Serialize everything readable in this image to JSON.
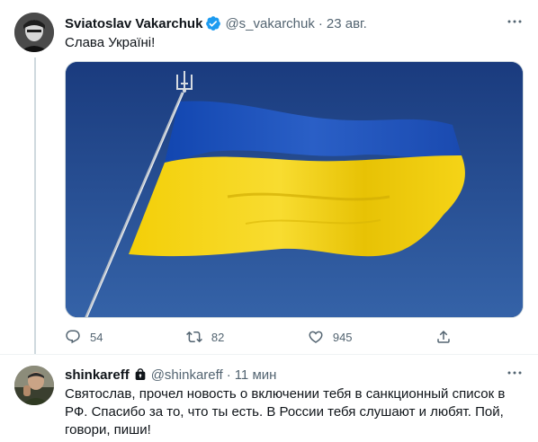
{
  "tweet": {
    "author": {
      "name": "Sviatoslav Vakarchuk",
      "handle": "@s_vakarchuk",
      "verified": true
    },
    "time": "23 авг.",
    "text": "Слава Україні!",
    "media": {
      "description": "Ukrainian flag on flagpole with trident finial",
      "colors": {
        "top": "#1c4fb0",
        "bottom": "#f5d50a",
        "sky": "#274a90"
      }
    },
    "actions": {
      "replies": "54",
      "retweets": "82",
      "likes": "945"
    }
  },
  "reply": {
    "author": {
      "name": "shinkareff",
      "handle": "@shinkareff",
      "protected": true
    },
    "time": "11 мин",
    "text": "Святослав, прочел новость о включении тебя в санкционный список в РФ. Спасибо за то, что ты есть. В России тебя слушают и любят. Пой, говори, пиши!"
  },
  "colors": {
    "accent": "#1d9bf0",
    "secondary_text": "#536471",
    "line": "#cfd9de"
  }
}
